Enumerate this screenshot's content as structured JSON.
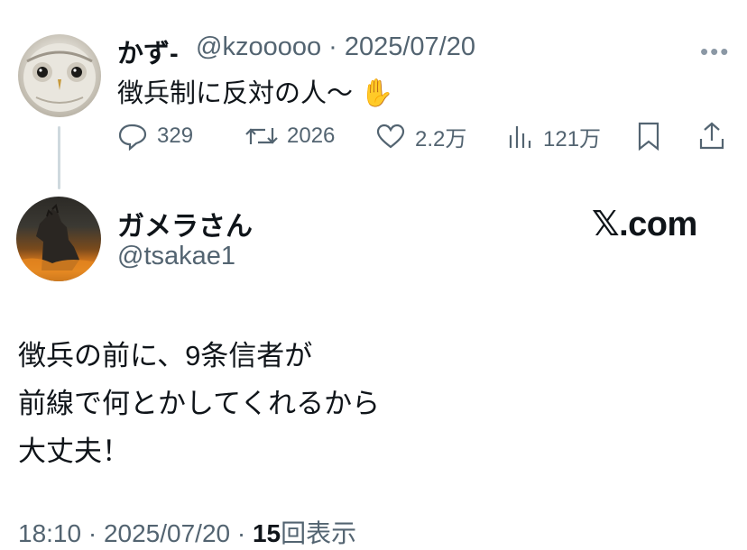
{
  "quoted_tweet": {
    "display_name": "かず-",
    "handle_and_date": "@kzooooo · 2025/07/20",
    "text": "徴兵制に反対の人〜",
    "emoji": "✋",
    "more_icon": "more-dots-icon",
    "actions": {
      "replies": "329",
      "reposts": "2026",
      "likes": "2.2万",
      "views": "121万"
    }
  },
  "main_tweet": {
    "display_name": "ガメラさん",
    "handle": "@tsakae1",
    "brand": "𝕏.com",
    "lines": [
      "徴兵の前に、9条信者が",
      "前線で何とかしてくれるから",
      "大丈夫！"
    ],
    "time_date": "18:10 · 2025/07/20 · ",
    "view_count": "15",
    "view_label": "回表示"
  }
}
